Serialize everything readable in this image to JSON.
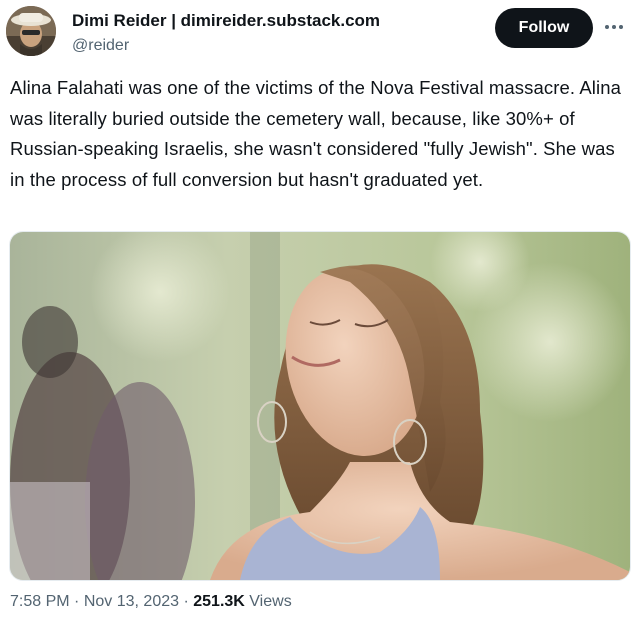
{
  "author": {
    "display_name": "Dimi Reider | dimireider.substack.com",
    "handle": "@reider"
  },
  "actions": {
    "follow_label": "Follow",
    "more_icon": "more-horizontal-icon"
  },
  "tweet": {
    "text": "Alina Falahati was one of the victims of the Nova Festival massacre. Alina was literally buried outside the cemetery wall, because, like 30%+ of Russian-speaking Israelis, she wasn't considered \"fully Jewish\". She was in the process of full conversion but hasn't graduated yet."
  },
  "meta": {
    "time": "7:58 PM",
    "separator": "·",
    "date": "Nov 13, 2023",
    "views_count": "251.3K",
    "views_label": "Views"
  },
  "colors": {
    "follow_bg": "#0f1419",
    "secondary_text": "#536471"
  }
}
